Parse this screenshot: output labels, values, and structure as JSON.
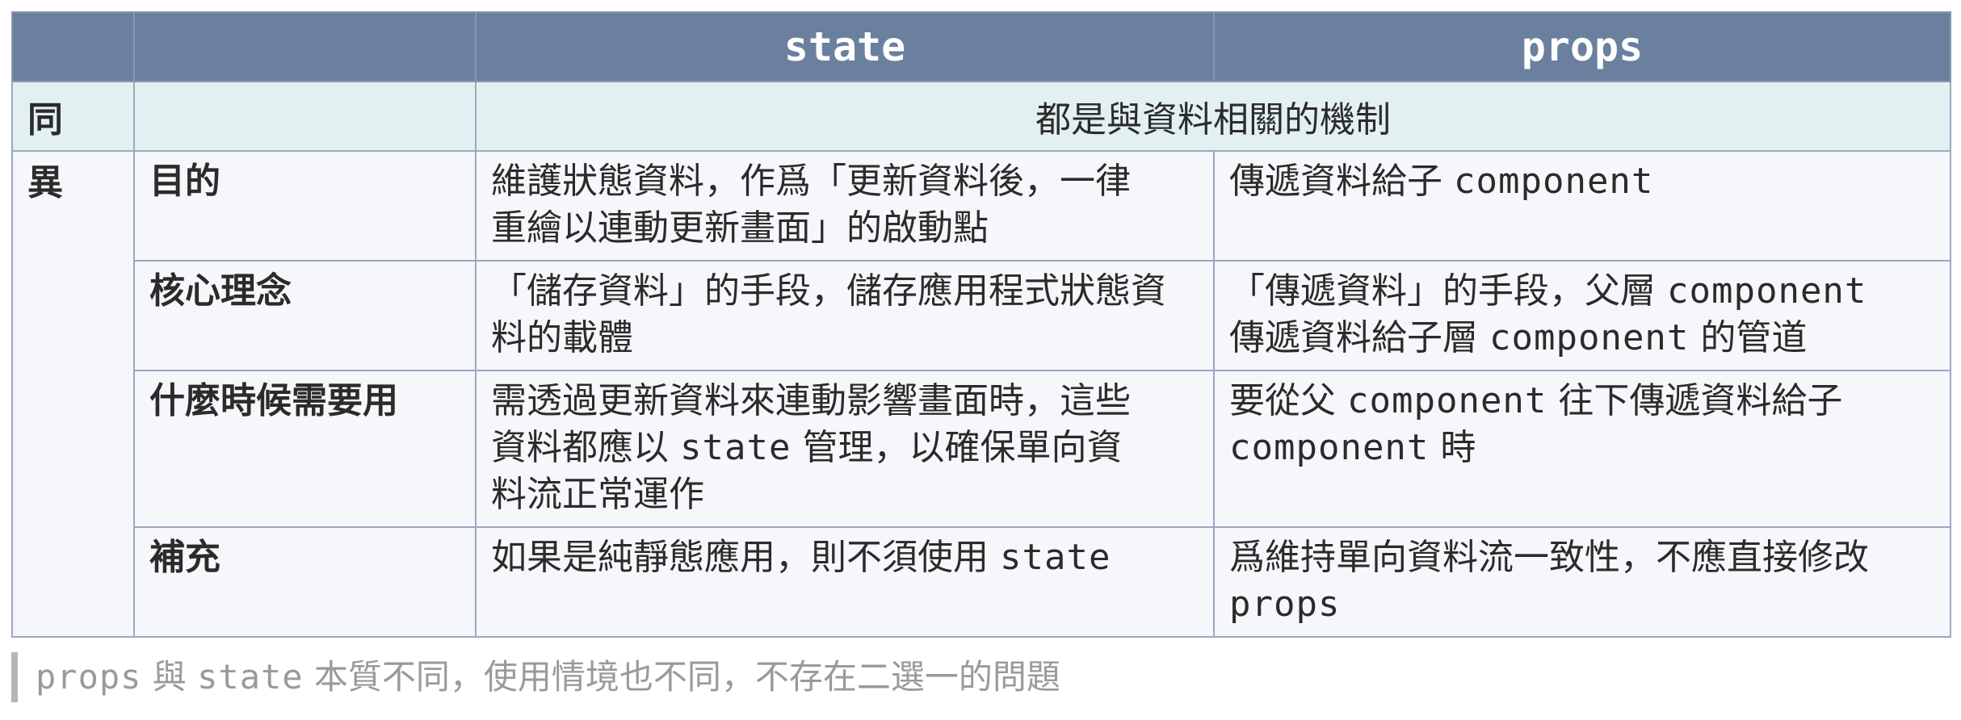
{
  "table": {
    "headers": [
      "",
      "",
      "state",
      "props"
    ],
    "same_row": {
      "side": "同",
      "content": "都是與資料相關的機制"
    },
    "diff_side": "異",
    "rows": [
      {
        "label": "目的",
        "state": [
          "維護狀態資料，作爲「更新資料後，一律",
          "重繪以連動更新畫面」的啟動點"
        ],
        "props": [
          "傳遞資料給子 ",
          "component"
        ]
      },
      {
        "label": "核心理念",
        "state": [
          "「儲存資料」的手段，儲存應用程式狀態資",
          "料的載體"
        ],
        "props": [
          "「傳遞資料」的手段，父層 ",
          "component",
          "傳遞資料給子層 ",
          "component",
          " 的管道"
        ]
      },
      {
        "label": "什麼時候需要用",
        "state": [
          "需透過更新資料來連動影響畫面時，這些",
          "資料都應以 ",
          "state",
          " 管理，以確保單向資",
          "料流正常運作"
        ],
        "props": [
          "要從父 ",
          "component",
          " 往下傳遞資料給子",
          "component",
          " 時"
        ]
      },
      {
        "label": "補充",
        "state": [
          "如果是純靜態應用，則不須使用 ",
          "state"
        ],
        "props": [
          "爲維持單向資料流一致性，不應直接修改",
          "props"
        ]
      }
    ]
  },
  "note": {
    "parts": [
      "props",
      " 與 ",
      "state",
      " 本質不同，使用情境也不同，不存在二選一的問題"
    ]
  }
}
